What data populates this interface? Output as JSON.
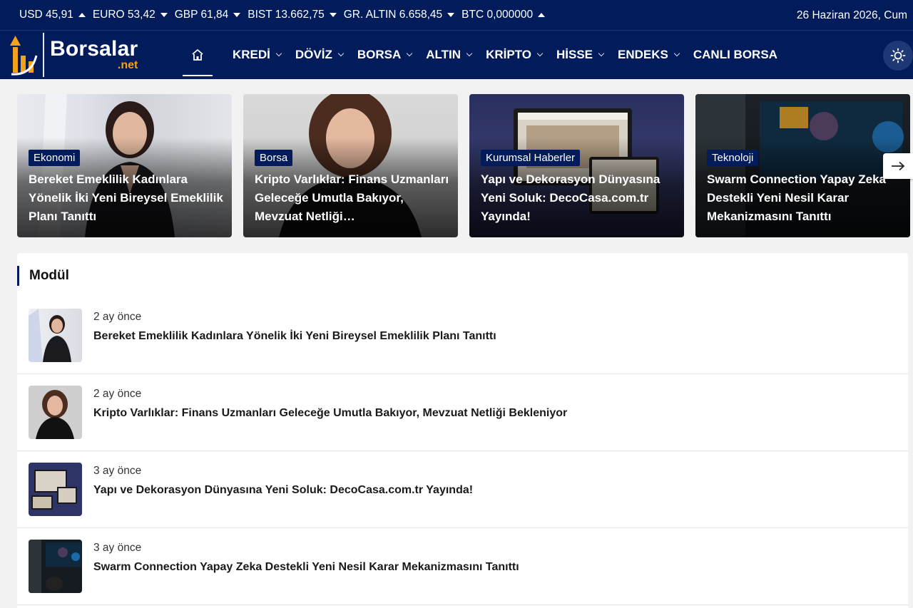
{
  "ticker": {
    "items": [
      {
        "label": "USD 45,91",
        "direction": "up"
      },
      {
        "label": "EURO 53,42",
        "direction": "down"
      },
      {
        "label": "GBP 61,84",
        "direction": "down"
      },
      {
        "label": "BIST 13.662,75",
        "direction": "down"
      },
      {
        "label": "GR. ALTIN 6.658,45",
        "direction": "down"
      },
      {
        "label": "BTC 0,000000",
        "direction": "up"
      }
    ],
    "date": "26 Haziran 2026, Cum"
  },
  "logo": {
    "name": "Borsalar",
    "tld": ".net"
  },
  "nav": {
    "home_icon": "home-icon",
    "items": [
      {
        "label": "KREDİ",
        "dropdown": true
      },
      {
        "label": "DÖVİZ",
        "dropdown": true
      },
      {
        "label": "BORSA",
        "dropdown": true
      },
      {
        "label": "ALTIN",
        "dropdown": true
      },
      {
        "label": "KRİPTO",
        "dropdown": true
      },
      {
        "label": "HİSSE",
        "dropdown": true
      },
      {
        "label": "ENDEKS",
        "dropdown": true
      },
      {
        "label": "CANLI BORSA",
        "dropdown": false
      }
    ],
    "theme_icon": "sun-icon"
  },
  "featured": [
    {
      "category": "Ekonomi",
      "title": "Bereket Emeklilik Kadınlara Yönelik İki Yeni Bireysel Emeklilik Planı Tanıttı"
    },
    {
      "category": "Borsa",
      "title": "Kripto Varlıklar: Finans Uzmanları Geleceğe Umutla Bakıyor, Mevzuat Netliği…"
    },
    {
      "category": "Kurumsal Haberler",
      "title": "Yapı ve Dekorasyon Dünyasına Yeni Soluk: DecoCasa.com.tr Yayında!"
    },
    {
      "category": "Teknoloji",
      "title": "Swarm Connection Yapay Zeka Destekli Yeni Nesil Karar Mekanizmasını Tanıttı"
    }
  ],
  "module": {
    "title": "Modül",
    "items": [
      {
        "time": "2 ay önce",
        "title": "Bereket Emeklilik Kadınlara Yönelik İki Yeni Bireysel Emeklilik Planı Tanıttı"
      },
      {
        "time": "2 ay önce",
        "title": "Kripto Varlıklar: Finans Uzmanları Geleceğe Umutla Bakıyor, Mevzuat Netliği Bekleniyor"
      },
      {
        "time": "3 ay önce",
        "title": "Yapı ve Dekorasyon Dünyasına Yeni Soluk: DecoCasa.com.tr Yayında!"
      },
      {
        "time": "3 ay önce",
        "title": "Swarm Connection Yapay Zeka Destekli Yeni Nesil Karar Mekanizmasını Tanıttı"
      }
    ]
  },
  "colors": {
    "primary": "#021c5b",
    "accent": "#f3a21a",
    "background": "#f2f2f2"
  }
}
